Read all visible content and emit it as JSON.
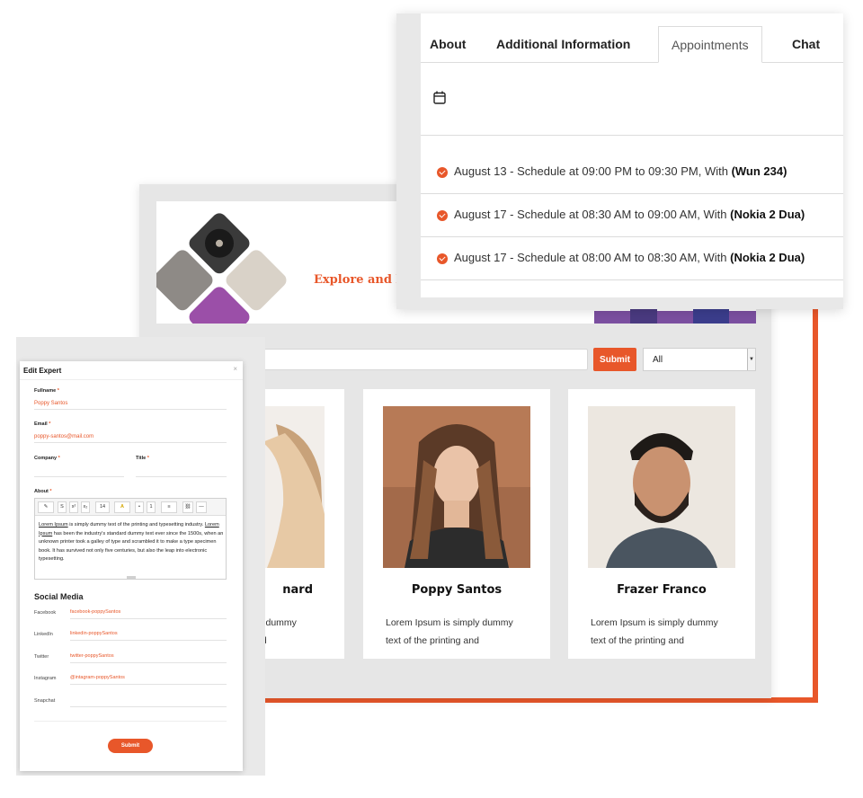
{
  "tabs": {
    "items": [
      {
        "label": "About"
      },
      {
        "label": "Additional Information"
      },
      {
        "label": "Appointments",
        "active": true
      },
      {
        "label": "Chat"
      }
    ],
    "appointments": [
      {
        "text": "August 13 - Schedule at 09:00 PM to 09:30 PM, With ",
        "with": "(Wun 234)"
      },
      {
        "text": "August 17 - Schedule at 08:30 AM to 09:00 AM, With ",
        "with": "(Nokia 2 Dua)"
      },
      {
        "text": "August 17 - Schedule at 08:00 AM to 08:30 AM, With ",
        "with": "(Nokia 2 Dua)"
      }
    ]
  },
  "directory": {
    "banner_text": "Explore and bo",
    "search_submit": "Submit",
    "filter_value": "All",
    "cards": [
      {
        "name": "nard",
        "desc_lines": [
          "ly dummy",
          "nd"
        ]
      },
      {
        "name": "Poppy Santos",
        "desc_lines": [
          "Lorem Ipsum is simply dummy",
          "text of the printing and"
        ]
      },
      {
        "name": "Frazer Franco",
        "desc_lines": [
          "Lorem Ipsum is simply dummy",
          "text of the printing and"
        ]
      }
    ]
  },
  "modal": {
    "title": "Edit Expert",
    "close": "×",
    "fullname_label": "Fullname",
    "fullname_value": "Poppy Santos",
    "email_label": "Email",
    "email_value": "poppy-santos@mail.com",
    "company_label": "Company",
    "title_label": "Title",
    "about_label": "About",
    "required_mark": "*",
    "toolbar": {
      "bold": "B",
      "font_size": "14",
      "list": "≡",
      "hr": "—"
    },
    "about_text_1": "Lorem Ipsum",
    "about_text_2": " is simply dummy text of the printing and typesetting industry. ",
    "about_text_3": "Lorem Ipsum",
    "about_text_4": " has been the industry's standard dummy text ever since the 1500s, when an unknown printer took a galley of type and scrambled it to make a type specimen book. It has survived not only five centuries, but also the leap into electronic typesetting.",
    "social_title": "Social Media",
    "social": [
      {
        "label": "Facebook",
        "value": "facebook-poppySantos"
      },
      {
        "label": "LinkedIn",
        "value": "linkedin-poppySantos"
      },
      {
        "label": "Twitter",
        "value": "twitter-poppySantos"
      },
      {
        "label": "Instagram",
        "value": "@intagram-poppySantos"
      },
      {
        "label": "Snapchat",
        "value": ""
      }
    ],
    "submit_label": "Submit"
  }
}
